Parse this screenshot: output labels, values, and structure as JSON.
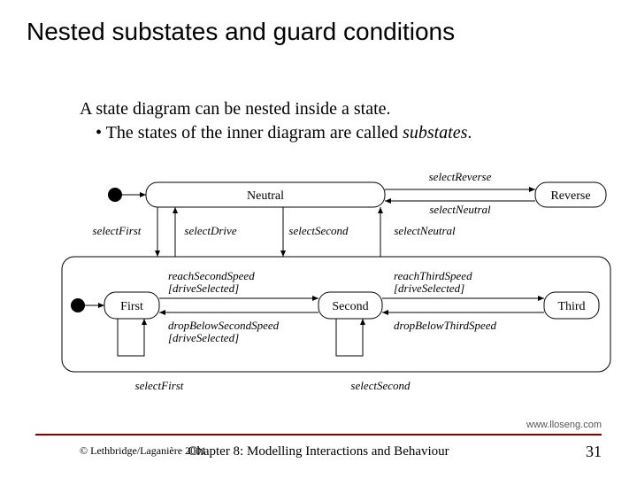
{
  "title": "Nested substates and guard conditions",
  "body": {
    "line1a": "A state diagram can be nested inside a state.",
    "bullet1a": "• The states of the inner diagram are called ",
    "bullet1b": "substates",
    "bullet1c": "."
  },
  "states": {
    "neutral": "Neutral",
    "reverse": "Reverse",
    "first": "First",
    "second": "Second",
    "third": "Third"
  },
  "trans": {
    "selectReverse": "selectReverse",
    "selectNeutral": "selectNeutral",
    "selectFirst": "selectFirst",
    "selectDrive": "selectDrive",
    "selectSecond": "selectSecond",
    "reachSecond1": "reachSecondSpeed",
    "reachSecond2": "[driveSelected]",
    "dropSecond1": "dropBelowSecondSpeed",
    "dropSecond2": "[driveSelected]",
    "reachThird1": "reachThirdSpeed",
    "reachThird2": "[driveSelected]",
    "dropThird": "dropBelowThirdSpeed",
    "loopSelectFirst": "selectFirst",
    "loopSelectSecond": "selectSecond"
  },
  "footer": {
    "url": "www.lloseng.com",
    "copyright": "© Lethbridge/Laganière 2001",
    "chapter": "Chapter 8: Modelling Interactions and Behaviour",
    "page": "31"
  }
}
